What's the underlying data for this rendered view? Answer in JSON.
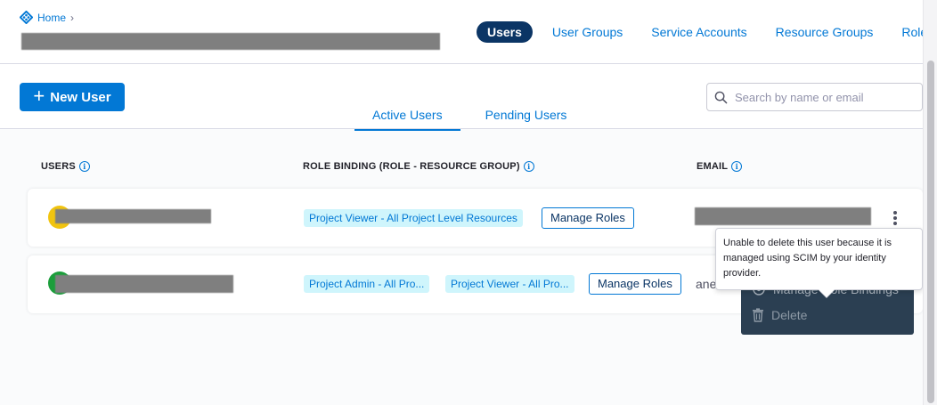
{
  "breadcrumb": {
    "home_label": "Home",
    "separator": "›"
  },
  "header": {
    "tabs": [
      {
        "label": "Users",
        "active": true
      },
      {
        "label": "User Groups",
        "active": false
      },
      {
        "label": "Service Accounts",
        "active": false
      },
      {
        "label": "Resource Groups",
        "active": false
      },
      {
        "label": "Roles",
        "active": false
      }
    ]
  },
  "toolbar": {
    "new_user_label": "New User",
    "search_placeholder": "Search by name or email",
    "sub_tabs": [
      {
        "label": "Active Users",
        "active": true
      },
      {
        "label": "Pending Users",
        "active": false
      }
    ]
  },
  "table": {
    "columns": {
      "users": "USERS",
      "role_binding": "ROLE BINDING (ROLE - RESOURCE GROUP)",
      "email": "EMAIL"
    },
    "rows": [
      {
        "avatar_color": "#f1c40f",
        "roles": [
          "Project Viewer - All Project Level Resources"
        ],
        "manage_label": "Manage Roles",
        "email_visible": ""
      },
      {
        "avatar_color": "#1b9e3b",
        "roles": [
          "Project Admin - All Pro...",
          "Project Viewer - All Pro..."
        ],
        "manage_label": "Manage Roles",
        "email_visible": "ane"
      }
    ]
  },
  "menu": {
    "items": [
      {
        "label": "Manage Role Bindings",
        "icon": "bindings-icon",
        "disabled": false
      },
      {
        "label": "Delete",
        "icon": "trash-icon",
        "disabled": true
      }
    ]
  },
  "tooltip": {
    "text": "Unable to delete this user because it is managed using SCIM by your identity provider."
  },
  "colors": {
    "accent": "#0278d5",
    "active_tab_bg": "#0b3565",
    "pill_bg": "#cff5fc",
    "menu_bg": "#2b3f52"
  }
}
